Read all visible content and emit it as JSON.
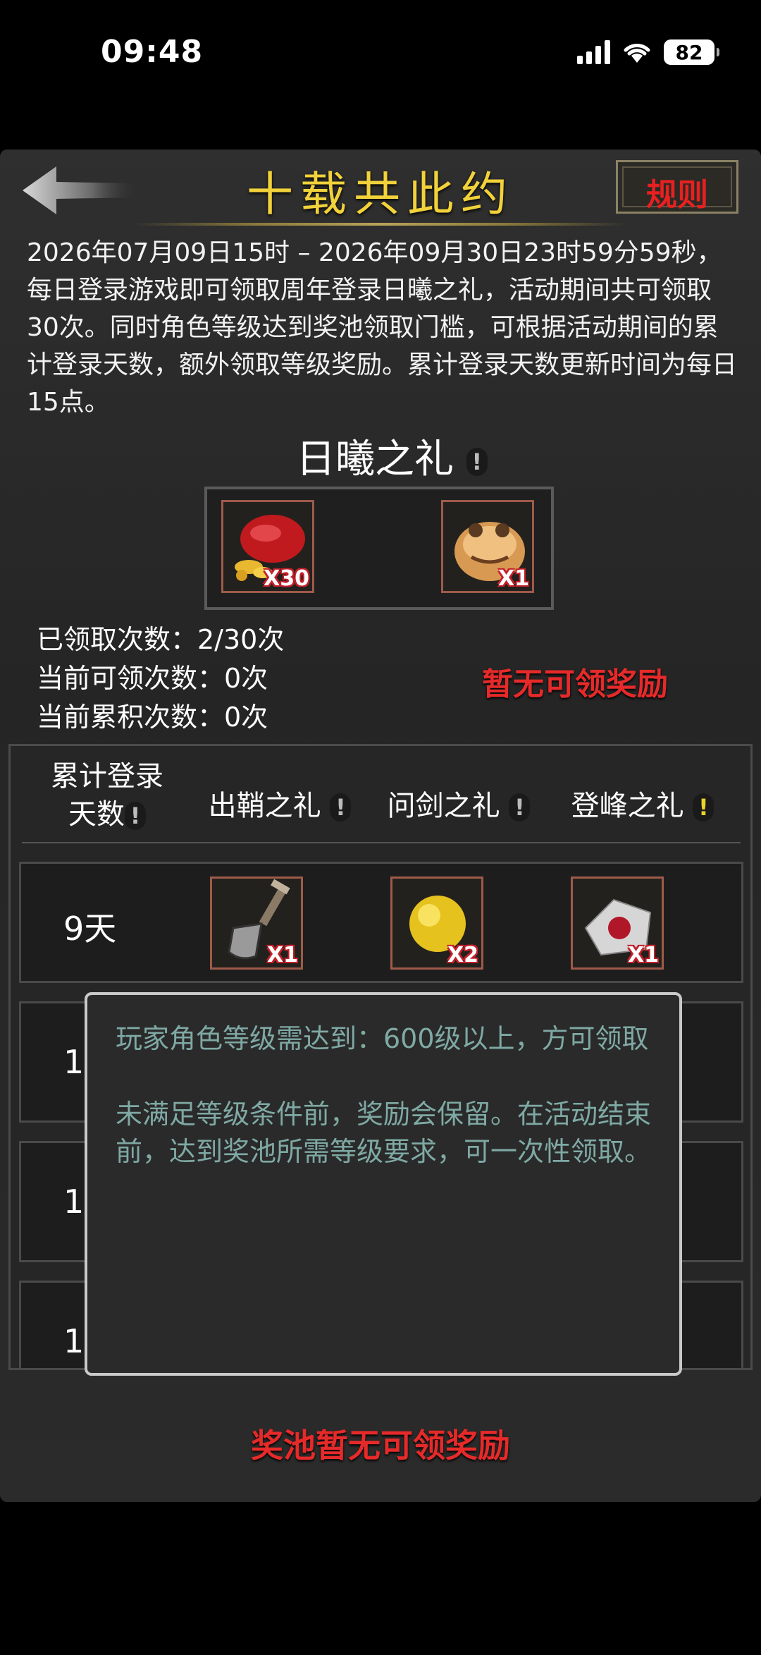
{
  "status_bar": {
    "time": "09:48",
    "battery": "82"
  },
  "header": {
    "title": "十载共此约",
    "rules_label": "规则"
  },
  "description": "2026年07月09日15时 – 2026年09月30日23时59分59秒，每日登录游戏即可领取周年登录日曦之礼，活动期间共可领取30次。同时角色等级达到奖池领取门槛，可根据活动期间的累计登录天数，额外领取等级奖励。累计登录天数更新时间为每日15点。",
  "daily_gift": {
    "title": "日曦之礼",
    "items": [
      {
        "icon": "red-pouch-gold-icon",
        "qty": "X30"
      },
      {
        "icon": "golden-toad-icon",
        "qty": "X1"
      }
    ]
  },
  "stats": {
    "claimed": "已领取次数：2/30次",
    "claimable": "当前可领次数：0次",
    "accumulated": "当前累积次数：0次"
  },
  "no_reward_text": "暂无可领奖励",
  "table": {
    "headers": [
      "累计登录天数",
      "出鞘之礼",
      "问剑之礼",
      "登峰之礼"
    ],
    "header_day_line1": "累计登录",
    "header_day_line2": "天数",
    "rows": [
      {
        "day": "9天",
        "items": [
          {
            "icon": "shovel-icon",
            "qty": "X1"
          },
          {
            "icon": "golden-orb-icon",
            "qty": "X2"
          },
          {
            "icon": "stone-ore-icon",
            "qty": "X1"
          }
        ]
      },
      {
        "day": "1"
      },
      {
        "day": "1"
      },
      {
        "day": "1"
      }
    ]
  },
  "tooltip": {
    "line1": "玩家角色等级需达到：600级以上，方可领取",
    "line2": "未满足等级条件前，奖励会保留。在活动结束前，达到奖池所需等级要求，可一次性领取。"
  },
  "pool_none_text": "奖池暂无可领奖励"
}
